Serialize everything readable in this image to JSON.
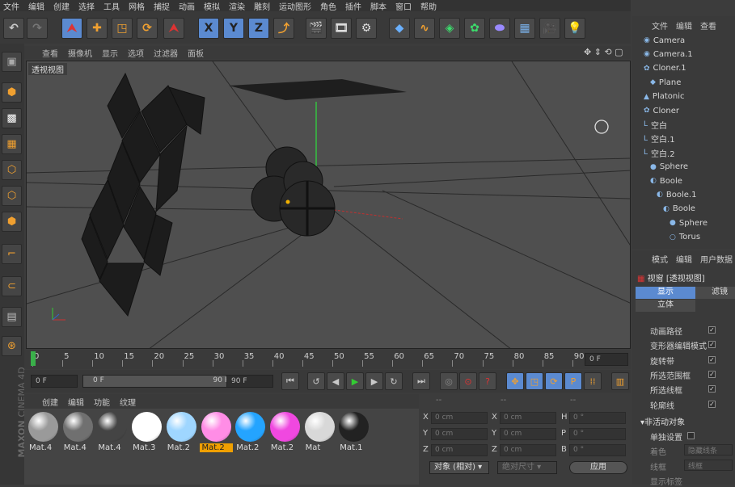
{
  "menubar": [
    "文件",
    "编辑",
    "创建",
    "选择",
    "工具",
    "网格",
    "捕捉",
    "动画",
    "模拟",
    "渲染",
    "雕刻",
    "运动图形",
    "角色",
    "插件",
    "脚本",
    "窗口",
    "帮助"
  ],
  "viewport": {
    "menu": [
      "查看",
      "摄像机",
      "显示",
      "选项",
      "过滤器",
      "面板"
    ],
    "label": "透视视图"
  },
  "timeline": {
    "ticks": [
      "0",
      "5",
      "10",
      "15",
      "20",
      "25",
      "30",
      "35",
      "40",
      "45",
      "50",
      "55",
      "60",
      "65",
      "70",
      "75",
      "80",
      "85",
      "90"
    ],
    "end_field": "0 F"
  },
  "transport": {
    "start": "0 F",
    "range_start": "0 F",
    "range_end": "90 F",
    "end": "90 F"
  },
  "materials": {
    "menu": [
      "创建",
      "编辑",
      "功能",
      "纹理"
    ],
    "items": [
      {
        "name": "Mat.4",
        "color": "#9a9a9a",
        "selected": false
      },
      {
        "name": "Mat.4",
        "color": "#707070",
        "selected": false
      },
      {
        "name": "Mat.4",
        "color": "#444444",
        "selected": false
      },
      {
        "name": "Mat.3",
        "color": "#ffffff",
        "selected": false
      },
      {
        "name": "Mat.2",
        "color": "#9fd6ff",
        "selected": false
      },
      {
        "name": "Mat.2",
        "color": "#ff8de6",
        "selected": true
      },
      {
        "name": "Mat.2",
        "color": "#24a4ff",
        "selected": false
      },
      {
        "name": "Mat.2",
        "color": "#f048e0",
        "selected": false
      },
      {
        "name": "Mat",
        "color": "#d8d8d8",
        "selected": false
      },
      {
        "name": "Mat.1",
        "color": "#222222",
        "selected": false
      }
    ]
  },
  "coords": {
    "headers": [
      "--",
      "--",
      "--"
    ],
    "rows": [
      {
        "a": "X",
        "av": "0 cm",
        "b": "X",
        "bv": "0 cm",
        "c": "H",
        "cv": "0 °"
      },
      {
        "a": "Y",
        "av": "0 cm",
        "b": "Y",
        "bv": "0 cm",
        "c": "P",
        "cv": "0 °"
      },
      {
        "a": "Z",
        "av": "0 cm",
        "b": "Z",
        "bv": "0 cm",
        "c": "B",
        "cv": "0 °"
      }
    ],
    "mode": "对象 (相对)",
    "size_mode": "绝对尺寸",
    "apply": "应用"
  },
  "objects": {
    "menu": [
      "文件",
      "编辑",
      "查看"
    ],
    "items": [
      {
        "name": "Camera",
        "indent": 0,
        "icon": "camera-icon"
      },
      {
        "name": "Camera.1",
        "indent": 0,
        "icon": "camera-icon"
      },
      {
        "name": "Cloner.1",
        "indent": 0,
        "icon": "cloner-icon"
      },
      {
        "name": "Plane",
        "indent": 1,
        "icon": "plane-icon"
      },
      {
        "name": "Platonic",
        "indent": 0,
        "icon": "platonic-icon"
      },
      {
        "name": "Cloner",
        "indent": 0,
        "icon": "cloner-icon"
      },
      {
        "name": "空白",
        "indent": 0,
        "icon": "null-icon"
      },
      {
        "name": "空白.1",
        "indent": 0,
        "icon": "null-icon"
      },
      {
        "name": "空白.2",
        "indent": 0,
        "icon": "null-icon"
      },
      {
        "name": "Sphere",
        "indent": 1,
        "icon": "sphere-icon"
      },
      {
        "name": "Boole",
        "indent": 1,
        "icon": "boole-icon"
      },
      {
        "name": "Boole.1",
        "indent": 2,
        "icon": "boole-icon"
      },
      {
        "name": "Boole",
        "indent": 3,
        "icon": "boole-icon"
      },
      {
        "name": "Sphere",
        "indent": 4,
        "icon": "sphere-icon"
      },
      {
        "name": "Torus",
        "indent": 4,
        "icon": "torus-icon"
      }
    ]
  },
  "attributes": {
    "menu": [
      "模式",
      "编辑",
      "用户数据"
    ],
    "title": "视窗 [透视视图]",
    "tabs": [
      "显示",
      "滤镜"
    ],
    "tab2": "立体",
    "options": [
      {
        "label": "动画路径",
        "checked": true
      },
      {
        "label": "变形器编辑模式",
        "checked": true
      },
      {
        "label": "旋转带",
        "checked": true
      },
      {
        "label": "所选范围框",
        "checked": true
      },
      {
        "label": "所选线框",
        "checked": true
      },
      {
        "label": "轮廓线",
        "checked": true
      }
    ],
    "section": "非活动对象",
    "single": "单独设置",
    "color_label": "着色",
    "color_value": "隐藏线条",
    "wire_label": "线框",
    "wire_value": "线框",
    "show_tags": "显示标签"
  },
  "brand": {
    "line1": "MAXON",
    "line2": "CINEMA 4D"
  }
}
